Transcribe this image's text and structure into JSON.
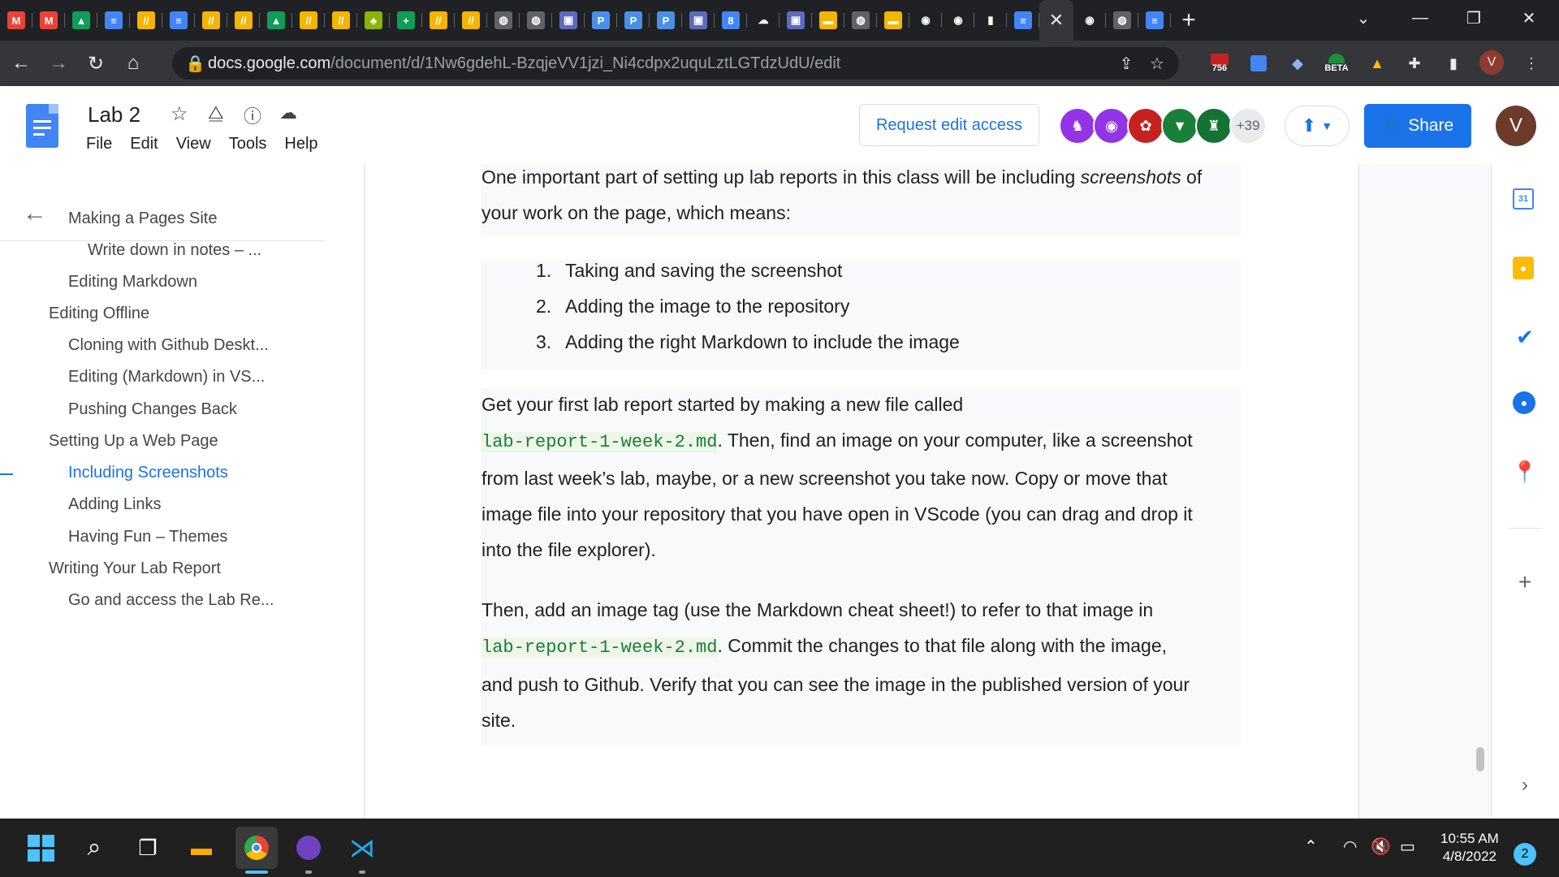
{
  "browser": {
    "tabs": [
      "gmail-icon",
      "gmail-icon",
      "drive-icon",
      "docs-icon",
      "slides-icon",
      "docs-icon",
      "slides-icon",
      "slides-icon",
      "drive-icon",
      "slides-icon",
      "slides-icon",
      "tree-icon",
      "sheets-icon",
      "slides-icon",
      "slides-icon",
      "globe-icon",
      "globe-icon",
      "forms-icon",
      "p-icon",
      "p-icon",
      "p-icon",
      "forms-icon",
      "calendar-icon",
      "cloud-icon",
      "forms-icon",
      "slides-yellow-icon",
      "globe-icon",
      "slides-yellow-icon",
      "github-icon",
      "github-icon",
      "chart-icon",
      "docs-icon"
    ],
    "active_tab_close": "✕",
    "after_tabs": [
      "github-icon",
      "globe-icon",
      "docs-icon"
    ],
    "new_tab": "+",
    "url_host": "docs.google.com",
    "url_path": "/document/d/1Nw6gdehL-BzqjeVV1jzi_Ni4cdpx2uquLztLGTdzUdU/edit",
    "ext_badge": "756",
    "ext_beta": "BETA",
    "profile_initial": "V"
  },
  "docs": {
    "title": "Lab 2",
    "menu": [
      "File",
      "Edit",
      "View",
      "Tools",
      "Help"
    ],
    "request_edit": "Request edit access",
    "more_collaborators": "+39",
    "share": "Share",
    "user_initial": "V"
  },
  "outline": {
    "items": [
      {
        "label": "Making a Pages Site"
      },
      {
        "label": "Write down in notes – ..."
      },
      {
        "label": "Editing Markdown"
      },
      {
        "label": "Editing Offline"
      },
      {
        "label": "Cloning with Github Deskt..."
      },
      {
        "label": "Editing (Markdown) in VS..."
      },
      {
        "label": "Pushing Changes Back"
      },
      {
        "label": "Setting Up a Web Page"
      },
      {
        "label": "Including Screenshots"
      },
      {
        "label": "Adding Links"
      },
      {
        "label": "Having Fun – Themes"
      },
      {
        "label": "Writing Your Lab Report"
      },
      {
        "label": "Go and access the Lab Re..."
      }
    ]
  },
  "content": {
    "p1_a": "One important part of setting up lab reports in this class will be including ",
    "p1_em": "screenshots",
    "p1_b": " of",
    "p1_line2": "your work on the page, which means:",
    "list": [
      {
        "num": "1.",
        "text": "Taking and saving the screenshot"
      },
      {
        "num": "2.",
        "text": "Adding the image to the repository"
      },
      {
        "num": "3.",
        "text": "Adding the right Markdown to include the image"
      }
    ],
    "p2_l1": "Get your first lab report started by making a new file called",
    "p2_code": "lab-report-1-week-2.md",
    "p2_l2": ". Then, find an image on your computer, like a screenshot",
    "p2_l3": "from last week’s lab, maybe, or a new screenshot you take now. Copy or move that",
    "p2_l4": "image file into your repository that you have open in VScode (you can drag and drop it",
    "p2_l5": "into the file explorer).",
    "p3_l1": "Then, add an image tag (use the Markdown cheat sheet!) to refer to that image in",
    "p3_code": "lab-report-1-week-2.md",
    "p3_l2": ". Commit the changes to that file along with the image,",
    "p3_l3": "and push to Github. Verify that you can see the image in the published version of your",
    "p3_l4": "site."
  },
  "taskbar": {
    "time": "10:55 AM",
    "date": "4/8/2022",
    "notifications": "2"
  }
}
